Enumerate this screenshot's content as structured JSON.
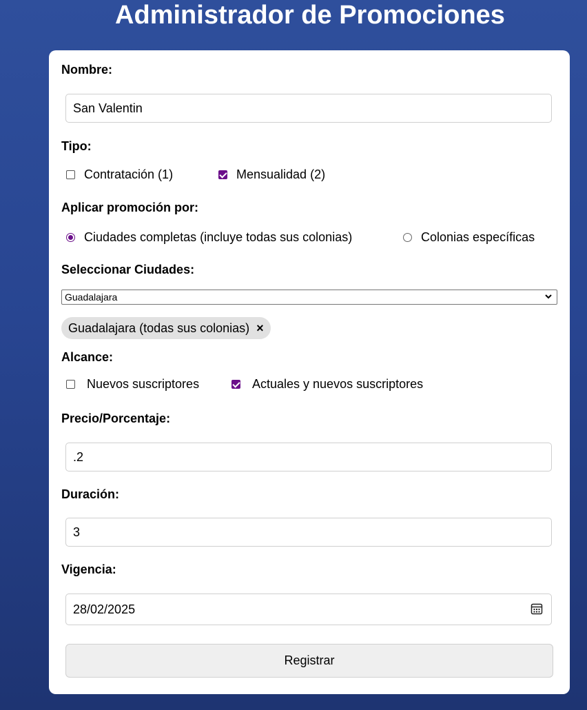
{
  "page": {
    "title": "Administrador de Promociones"
  },
  "form": {
    "nombre": {
      "label": "Nombre:",
      "value": "San Valentin"
    },
    "tipo": {
      "label": "Tipo:",
      "options": [
        {
          "label": "Contratación (1)",
          "checked": false
        },
        {
          "label": "Mensualidad (2)",
          "checked": true
        }
      ]
    },
    "aplicar": {
      "label": "Aplicar promoción por:",
      "options": [
        {
          "label": "Ciudades completas (incluye todas sus colonias)",
          "checked": true
        },
        {
          "label": "Colonias específicas",
          "checked": false
        }
      ]
    },
    "ciudades": {
      "label": "Seleccionar Ciudades:",
      "selected": "Guadalajara",
      "tag": "Guadalajara (todas sus colonias)",
      "tag_remove": "×"
    },
    "alcance": {
      "label": "Alcance:",
      "options": [
        {
          "label": "Nuevos suscriptores",
          "checked": false
        },
        {
          "label": "Actuales y nuevos suscriptores",
          "checked": true
        }
      ]
    },
    "precio": {
      "label": "Precio/Porcentaje:",
      "value": ".2"
    },
    "duracion": {
      "label": "Duración:",
      "value": "3"
    },
    "vigencia": {
      "label": "Vigencia:",
      "value": "28/02/2025",
      "icon": "calendar-icon"
    },
    "submit_label": "Registrar"
  },
  "colors": {
    "background_top": "#2f4f9c",
    "background_bottom": "#1e3472",
    "accent": "#6b0f8a",
    "tag_bg": "#e1e1e1",
    "button_bg": "#efefef"
  }
}
